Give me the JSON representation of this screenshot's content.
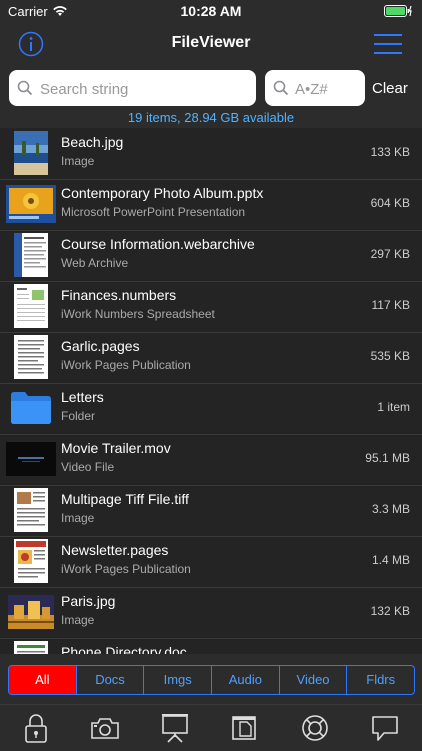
{
  "status": {
    "carrier": "Carrier",
    "time": "10:28 AM"
  },
  "nav": {
    "title": "FileViewer"
  },
  "search": {
    "placeholder": "Search string",
    "sort_placeholder": "A•Z#",
    "clear_label": "Clear"
  },
  "summary": "19 items, 28.94 GB available",
  "files": [
    {
      "name": "Beach.jpg",
      "kind": "Image",
      "size": "133 KB",
      "icon": "beach-image-thumbnail"
    },
    {
      "name": "Contemporary Photo Album.pptx",
      "kind": "Microsoft PowerPoint Presentation",
      "size": "604 KB",
      "icon": "pptx-thumbnail"
    },
    {
      "name": "Course Information.webarchive",
      "kind": "Web Archive",
      "size": "297 KB",
      "icon": "webarchive-thumbnail"
    },
    {
      "name": "Finances.numbers",
      "kind": "iWork Numbers Spreadsheet",
      "size": "117 KB",
      "icon": "numbers-thumbnail"
    },
    {
      "name": "Garlic.pages",
      "kind": "iWork Pages Publication",
      "size": "535 KB",
      "icon": "pages-thumbnail"
    },
    {
      "name": "Letters",
      "kind": "Folder",
      "size": "1 item",
      "icon": "folder-icon"
    },
    {
      "name": "Movie Trailer.mov",
      "kind": "Video File",
      "size": "95.1 MB",
      "icon": "video-thumbnail"
    },
    {
      "name": "Multipage Tiff File.tiff",
      "kind": "Image",
      "size": "3.3 MB",
      "icon": "tiff-thumbnail"
    },
    {
      "name": "Newsletter.pages",
      "kind": "iWork Pages Publication",
      "size": "1.4 MB",
      "icon": "newsletter-thumbnail"
    },
    {
      "name": "Paris.jpg",
      "kind": "Image",
      "size": "132 KB",
      "icon": "paris-image-thumbnail"
    },
    {
      "name": "Phone Directory.doc",
      "kind": "",
      "size": "",
      "icon": "doc-thumbnail"
    }
  ],
  "filters": [
    "All",
    "Docs",
    "Imgs",
    "Audio",
    "Video",
    "Fldrs"
  ],
  "active_filter": "All",
  "toolbar": [
    "lock-icon",
    "camera-icon",
    "presentation-icon",
    "document-icon",
    "lifebuoy-icon",
    "speech-bubble-icon"
  ],
  "colors": {
    "accent": "#2e78ff",
    "active_filter": "#ff0000",
    "summary_text": "#4fb3ff",
    "battery": "#4cd964"
  }
}
